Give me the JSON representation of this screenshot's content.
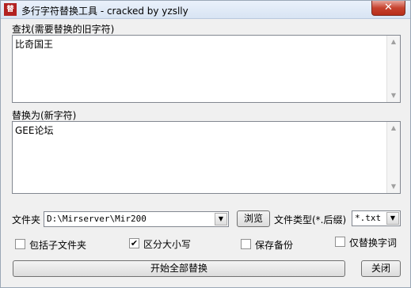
{
  "window": {
    "icon_text": "替",
    "title": "多行字符替换工具 - cracked by yzslly",
    "close_glyph": "✕"
  },
  "find": {
    "label": "查找(需要替换的旧字符)",
    "value": "比奇国王"
  },
  "replace": {
    "label": "替换为(新字符)",
    "value": "GEE论坛"
  },
  "folder": {
    "label": "文件夹",
    "value": "D:\\Mirserver\\Mir200",
    "browse_label": "浏览"
  },
  "filetype": {
    "label": "文件类型(*.后缀)",
    "value": "*.txt"
  },
  "options": {
    "include_subfolders": {
      "label": "包括子文件夹",
      "checked": false
    },
    "case_sensitive": {
      "label": "区分大小写",
      "checked": true
    },
    "save_backup": {
      "label": "保存备份",
      "checked": false
    },
    "replace_word_only": {
      "label": "仅替换字词",
      "checked": false
    }
  },
  "actions": {
    "replace_all_label": "开始全部替换",
    "close_label": "关闭"
  },
  "icons": {
    "scroll_up": "▲",
    "scroll_down": "▼",
    "dropdown": "▼",
    "check": "✔"
  }
}
